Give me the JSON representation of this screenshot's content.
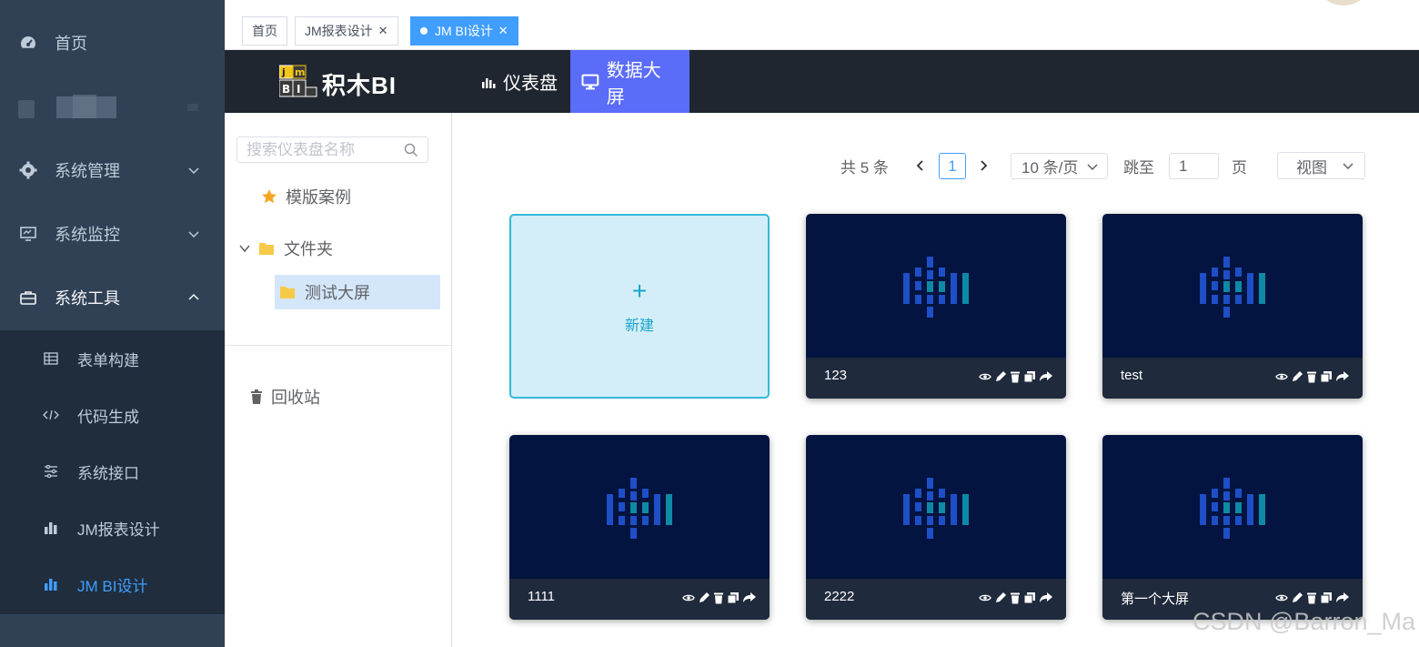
{
  "sidebar": {
    "items": [
      {
        "label": "首页",
        "icon": "dashboard-icon"
      },
      {
        "label": "",
        "icon": "blurred-icon"
      },
      {
        "label": "系统管理",
        "icon": "gear-icon"
      },
      {
        "label": "系统监控",
        "icon": "monitor-icon"
      },
      {
        "label": "系统工具",
        "icon": "toolbox-icon"
      }
    ],
    "submenu": [
      {
        "label": "表单构建",
        "icon": "table-icon"
      },
      {
        "label": "代码生成",
        "icon": "code-icon"
      },
      {
        "label": "系统接口",
        "icon": "sliders-icon"
      },
      {
        "label": "JM报表设计",
        "icon": "bar-chart-icon"
      },
      {
        "label": "JM BI设计",
        "icon": "bar-chart-icon"
      }
    ]
  },
  "tags": [
    {
      "label": "首页"
    },
    {
      "label": "JM报表设计"
    },
    {
      "label": "JM BI设计"
    }
  ],
  "bi_header": {
    "logo_text": "积木BI",
    "logo_badge": "jm BI",
    "tabs": [
      {
        "label": "仪表盘",
        "icon": "bar-chart-icon"
      },
      {
        "label": "数据大屏",
        "icon": "monitor-icon"
      }
    ]
  },
  "tree": {
    "search_placeholder": "搜索仪表盘名称",
    "nodes": [
      {
        "label": "模版案例",
        "icon": "star-icon"
      },
      {
        "label": "文件夹",
        "icon": "folder-icon"
      },
      {
        "label": "测试大屏",
        "icon": "folder-icon"
      }
    ],
    "recycle_label": "回收站"
  },
  "pager": {
    "total": "共 5 条",
    "current_page": "1",
    "page_size": "10 条/页",
    "jump_label": "跳至",
    "jump_value": "1",
    "page_unit": "页",
    "view_label": "视图"
  },
  "cards": {
    "new_plus": "+",
    "new_label": "新建",
    "items": [
      {
        "name": "123"
      },
      {
        "name": "test"
      },
      {
        "name": "1111"
      },
      {
        "name": "2222"
      },
      {
        "name": "第一个大屏"
      }
    ]
  },
  "watermark": "CSDN @Barron_Ma",
  "colors": {
    "sidebar_bg": "#304156",
    "submenu_bg": "#1f2d3d",
    "active_blue": "#409eff",
    "bi_header_bg": "#20262f",
    "bi_tab_active": "#5a6cf8",
    "card_bg": "#02143f"
  }
}
